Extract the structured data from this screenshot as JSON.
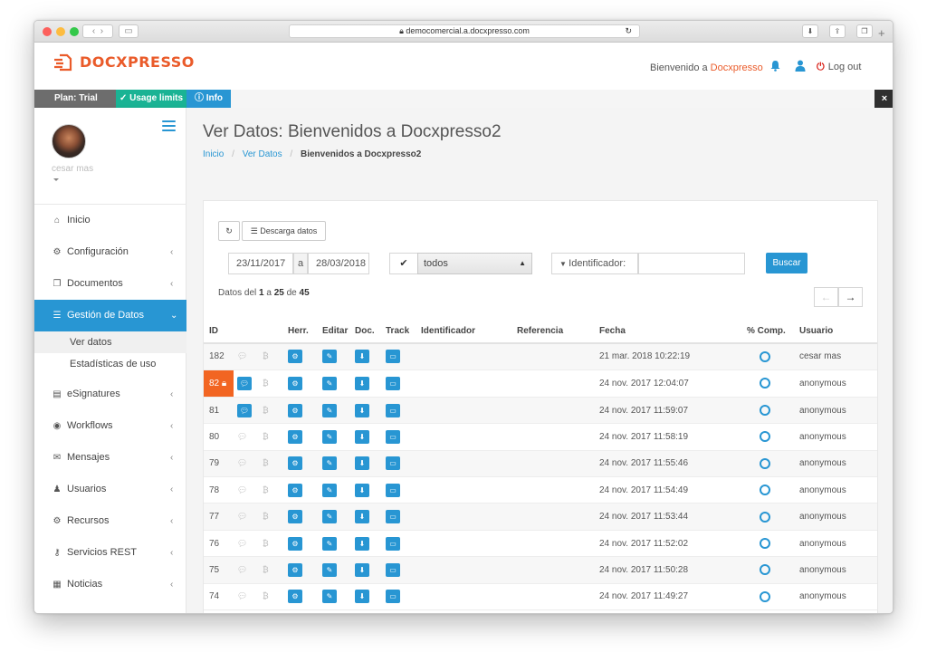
{
  "browser": {
    "url": "democomercial.a.docxpresso.com",
    "reload_icon": "reload-icon",
    "back_icon": "chevron-left-icon",
    "forward_icon": "chevron-right-icon",
    "sidebar_icon": "sidebar-icon",
    "download_icon": "download-icon",
    "share_icon": "share-icon",
    "tabs_icon": "tabs-icon",
    "newtab_icon": "plus-icon"
  },
  "brand": {
    "name": "DOCXPRESSO",
    "color": "#ea5b2a",
    "accent": "#2896d3",
    "success": "#1ab394",
    "warning": "#f26522"
  },
  "header": {
    "welcome_prefix": "Bienvenido a",
    "welcome_user": "Docxpresso",
    "logout_label": "Log out"
  },
  "topstrip": {
    "plan": "Plan: Trial",
    "usage": "Usage limits",
    "info": "Info",
    "close": "×"
  },
  "sidebar": {
    "user_name": "cesar mas",
    "items": [
      {
        "label": "Inicio",
        "icon": "home-icon",
        "glyph": "⌂"
      },
      {
        "label": "Configuración",
        "icon": "gear-icon",
        "glyph": "⚙"
      },
      {
        "label": "Documentos",
        "icon": "files-icon",
        "glyph": "❐"
      },
      {
        "label": "Gestión de Datos",
        "icon": "database-icon",
        "glyph": "☰"
      },
      {
        "label": "eSignatures",
        "icon": "id-card-icon",
        "glyph": "▤"
      },
      {
        "label": "Workflows",
        "icon": "globe-icon",
        "glyph": "◉"
      },
      {
        "label": "Mensajes",
        "icon": "envelope-icon",
        "glyph": "✉"
      },
      {
        "label": "Usuarios",
        "icon": "users-icon",
        "glyph": "♟"
      },
      {
        "label": "Recursos",
        "icon": "cogs-icon",
        "glyph": "⚙"
      },
      {
        "label": "Servicios REST",
        "icon": "key-icon",
        "glyph": "⚷"
      },
      {
        "label": "Noticias",
        "icon": "newspaper-icon",
        "glyph": "▦"
      }
    ],
    "subitems": [
      {
        "label": "Ver datos"
      },
      {
        "label": "Estadísticas de uso"
      }
    ]
  },
  "page": {
    "title": "Ver Datos: Bienvenidos a Docxpresso2",
    "breadcrumb": [
      "Inicio",
      "Ver Datos",
      "Bienvenidos a Docxpresso2"
    ]
  },
  "toolbar": {
    "download_label": "Descarga datos",
    "date_from": "23/11/2017",
    "date_sep": "a",
    "date_to": "28/03/2018",
    "filter_value": "todos",
    "identifier_label": "Identificador:",
    "identifier_value": "",
    "search_label": "Buscar"
  },
  "pagination": {
    "prefix": "Datos del",
    "from": "1",
    "mid1": "a",
    "to": "25",
    "mid2": "de",
    "total": "45"
  },
  "table": {
    "headers": [
      "ID",
      "",
      "",
      "Herr.",
      "Editar",
      "Doc.",
      "Track",
      "Identificador",
      "Referencia",
      "Fecha",
      "% Comp.",
      "Usuario"
    ],
    "rows": [
      {
        "id": "182",
        "date": "21 mar. 2018 10:22:19",
        "user": "cesar mas",
        "comp": 0
      },
      {
        "id": "82",
        "date": "24 nov. 2017 12:04:07",
        "user": "anonymous",
        "comp": 0
      },
      {
        "id": "81",
        "date": "24 nov. 2017 11:59:07",
        "user": "anonymous",
        "comp": 0
      },
      {
        "id": "80",
        "date": "24 nov. 2017 11:58:19",
        "user": "anonymous",
        "comp": 0
      },
      {
        "id": "79",
        "date": "24 nov. 2017 11:55:46",
        "user": "anonymous",
        "comp": 0
      },
      {
        "id": "78",
        "date": "24 nov. 2017 11:54:49",
        "user": "anonymous",
        "comp": 0
      },
      {
        "id": "77",
        "date": "24 nov. 2017 11:53:44",
        "user": "anonymous",
        "comp": 0
      },
      {
        "id": "76",
        "date": "24 nov. 2017 11:52:02",
        "user": "anonymous",
        "comp": 0
      },
      {
        "id": "75",
        "date": "24 nov. 2017 11:50:28",
        "user": "anonymous",
        "comp": 0
      },
      {
        "id": "74",
        "date": "24 nov. 2017 11:49:27",
        "user": "anonymous",
        "comp": 0
      }
    ]
  }
}
